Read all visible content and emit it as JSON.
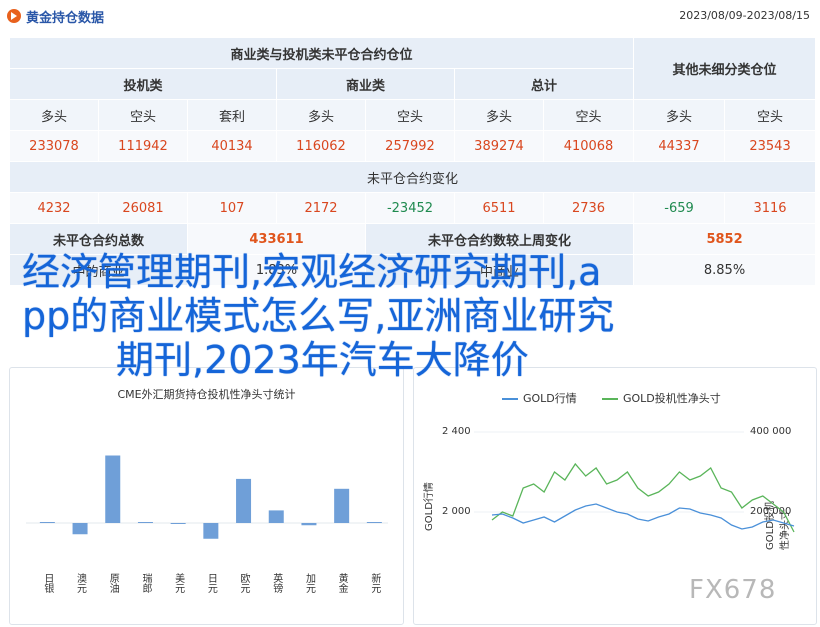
{
  "header": {
    "title": "黄金持仓数据",
    "date_range": "2023/08/09-2023/08/15"
  },
  "table": {
    "group_commercial": "商业类与投机类未平仓合约仓位",
    "group_other": "其他未细分类仓位",
    "spec": "投机类",
    "comm": "商业类",
    "total": "总计",
    "sub_labels": [
      "多头",
      "空头",
      "套利",
      "多头",
      "空头",
      "多头",
      "空头",
      "多头",
      "空头"
    ],
    "values": [
      "233078",
      "111942",
      "40134",
      "116062",
      "257992",
      "389274",
      "410068",
      "44337",
      "23543"
    ],
    "change_title": "未平仓合约变化",
    "changes": [
      "4232",
      "26081",
      "107",
      "2172",
      "-23452",
      "6511",
      "2736",
      "-659",
      "3116"
    ],
    "oi_total_label": "未平仓合约总数",
    "oi_total_value": "433611",
    "oi_change_label": "未平仓合约数较上周变化",
    "oi_change_value": "5852",
    "hidden_row": [
      "中的商业",
      "中商业",
      "1.83%",
      "8.85%"
    ]
  },
  "overlay": {
    "line1": "经济管理期刊,宏观经济研究期刊,a",
    "line2": "pp的商业模式怎么写,亚洲商业研究",
    "line3": "期刊,2023年汽车大降价"
  },
  "watermark": "FX678",
  "chart_data": [
    {
      "type": "bar",
      "title": "CME外汇期货持仓投机性净头寸统计",
      "categories": [
        "日银",
        "澳元",
        "原油",
        "瑞郎",
        "美元",
        "日元",
        "欧元",
        "英镑",
        "加元",
        "黄金",
        "新元"
      ],
      "values": [
        0.2,
        -2.5,
        15.0,
        0.1,
        -0.1,
        -3.5,
        9.8,
        2.8,
        -0.5,
        7.6,
        0
      ],
      "colors": {
        "bar": "#6f9fd8"
      }
    },
    {
      "type": "line",
      "series": [
        {
          "name": "GOLD行情",
          "color": "#4a90d9",
          "axis": "left"
        },
        {
          "name": "GOLD投机性净头寸",
          "color": "#5ab55a",
          "axis": "right"
        }
      ],
      "y_left_ticks": [
        "2 400",
        "2 000"
      ],
      "y_right_ticks": [
        "400 000",
        "200 000"
      ],
      "ylabel_left": "GOLD行情",
      "ylabel_right": "GOLD投机性净头寸",
      "gold_price": [
        1985,
        1990,
        1970,
        1945,
        1960,
        1975,
        1950,
        1980,
        2010,
        2030,
        2040,
        2020,
        2000,
        1990,
        1965,
        1955,
        1975,
        1990,
        2020,
        2015,
        1995,
        1985,
        1970,
        1935,
        1915,
        1925,
        1950,
        1960,
        1945,
        1930
      ],
      "net_positions": [
        180000,
        200000,
        190000,
        260000,
        270000,
        250000,
        300000,
        280000,
        320000,
        290000,
        310000,
        270000,
        280000,
        300000,
        260000,
        240000,
        250000,
        270000,
        300000,
        280000,
        290000,
        310000,
        260000,
        250000,
        210000,
        230000,
        240000,
        220000,
        200000,
        150000
      ]
    }
  ]
}
